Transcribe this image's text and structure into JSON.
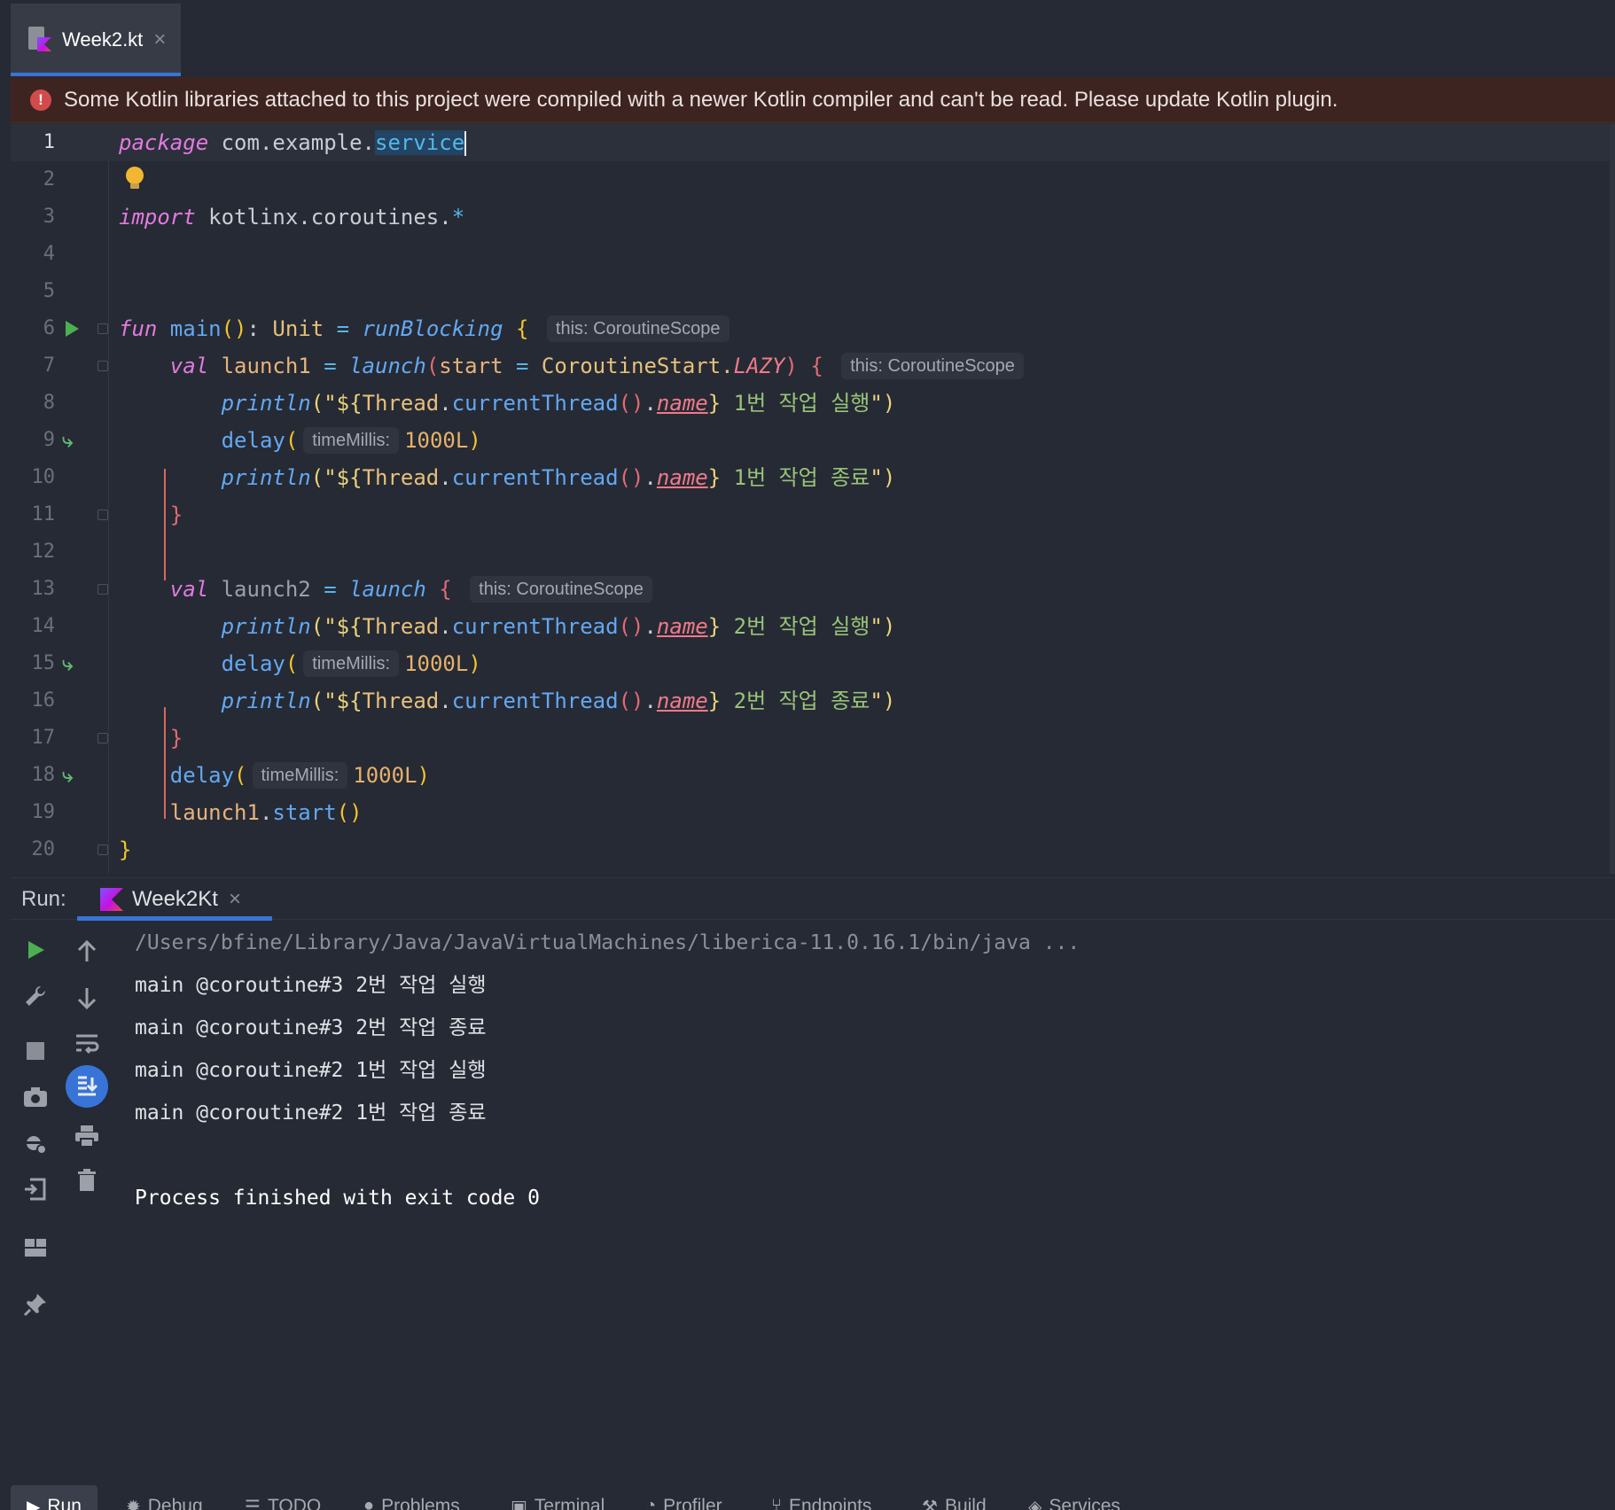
{
  "editor_tab": {
    "label": "Week2.kt",
    "close": "×"
  },
  "banner": {
    "icon": "!",
    "message": "Some Kotlin libraries attached to this project were compiled with a newer Kotlin compiler and can't be read. Please update Kotlin plugin."
  },
  "editor": {
    "line_numbers": [
      "1",
      "2",
      "3",
      "4",
      "5",
      "6",
      "7",
      "8",
      "9",
      "10",
      "11",
      "12",
      "13",
      "14",
      "15",
      "16",
      "17",
      "18",
      "19",
      "20"
    ],
    "code": {
      "l1": {
        "kw": "package",
        "pkg": " com.example.",
        "sel": "service"
      },
      "l3": {
        "kw": "import",
        "path": " kotlinx.coroutines.",
        "star": "*"
      },
      "l6": {
        "kw": "fun",
        "name": " main",
        "paren": "()",
        "colon": ": ",
        "type": "Unit",
        "eq": " = ",
        "call": "runBlocking",
        "brace": " {",
        "hint": "this: CoroutineScope"
      },
      "l7": {
        "kw": "val",
        "name": " launch1",
        "eq": " = ",
        "call": "launch",
        "open": "(",
        "arg": "start",
        "eq2": " = ",
        "cls": "CoroutineStart.",
        "lazy": "LAZY",
        "close": ")",
        "brace": " {",
        "hint": "this: CoroutineScope"
      },
      "l8": {
        "call": "println",
        "open": "(",
        "q": "\"${",
        "thread": "Thread",
        "dot": ".",
        "cur": "currentThread",
        "par": "()",
        "dot2": ".",
        "prop": "name",
        "cb": "}",
        "text": " 1번 작업 실행",
        "end": "\")"
      },
      "l9": {
        "call": "delay",
        "open": "(",
        "hint": "timeMillis:",
        "num": "1000L",
        "close": ")"
      },
      "l10": {
        "call": "println",
        "open": "(",
        "q": "\"${",
        "thread": "Thread",
        "dot": ".",
        "cur": "currentThread",
        "par": "()",
        "dot2": ".",
        "prop": "name",
        "cb": "}",
        "text": " 1번 작업 종료",
        "end": "\")"
      },
      "l11": {
        "brace": "}"
      },
      "l13": {
        "kw": "val",
        "name": " launch2",
        "eq": " = ",
        "call": "launch",
        "brace": " {",
        "hint": "this: CoroutineScope"
      },
      "l14": {
        "call": "println",
        "open": "(",
        "q": "\"${",
        "thread": "Thread",
        "dot": ".",
        "cur": "currentThread",
        "par": "()",
        "dot2": ".",
        "prop": "name",
        "cb": "}",
        "text": " 2번 작업 실행",
        "end": "\")"
      },
      "l15": {
        "call": "delay",
        "open": "(",
        "hint": "timeMillis:",
        "num": "1000L",
        "close": ")"
      },
      "l16": {
        "call": "println",
        "open": "(",
        "q": "\"${",
        "thread": "Thread",
        "dot": ".",
        "cur": "currentThread",
        "par": "()",
        "dot2": ".",
        "prop": "name",
        "cb": "}",
        "text": " 2번 작업 종료",
        "end": "\")"
      },
      "l17": {
        "brace": "}"
      },
      "l18": {
        "call": "delay",
        "open": "(",
        "hint": "timeMillis:",
        "num": "1000L",
        "close": ")"
      },
      "l19": {
        "name": "launch1",
        "dot": ".",
        "call": "start",
        "par": "()"
      },
      "l20": {
        "brace": "}"
      }
    }
  },
  "run_panel": {
    "title": "Run:",
    "tab_label": "Week2Kt",
    "tab_close": "×",
    "console": [
      "/Users/bfine/Library/Java/JavaVirtualMachines/liberica-11.0.16.1/bin/java ...",
      "main @coroutine#3 2번 작업 실행",
      "main @coroutine#3 2번 작업 종료",
      "main @coroutine#2 1번 작업 실행",
      "main @coroutine#2 1번 작업 종료",
      "Process finished with exit code 0"
    ]
  },
  "bottom_bar": {
    "items": [
      "Run",
      "Debug",
      "TODO",
      "Problems",
      "Terminal",
      "Profiler",
      "Endpoints",
      "Build",
      "Services"
    ]
  },
  "colors": {
    "accent": "#3874d8",
    "background": "#262a34",
    "banner": "#3e2421",
    "run_green": "#4caf50"
  }
}
